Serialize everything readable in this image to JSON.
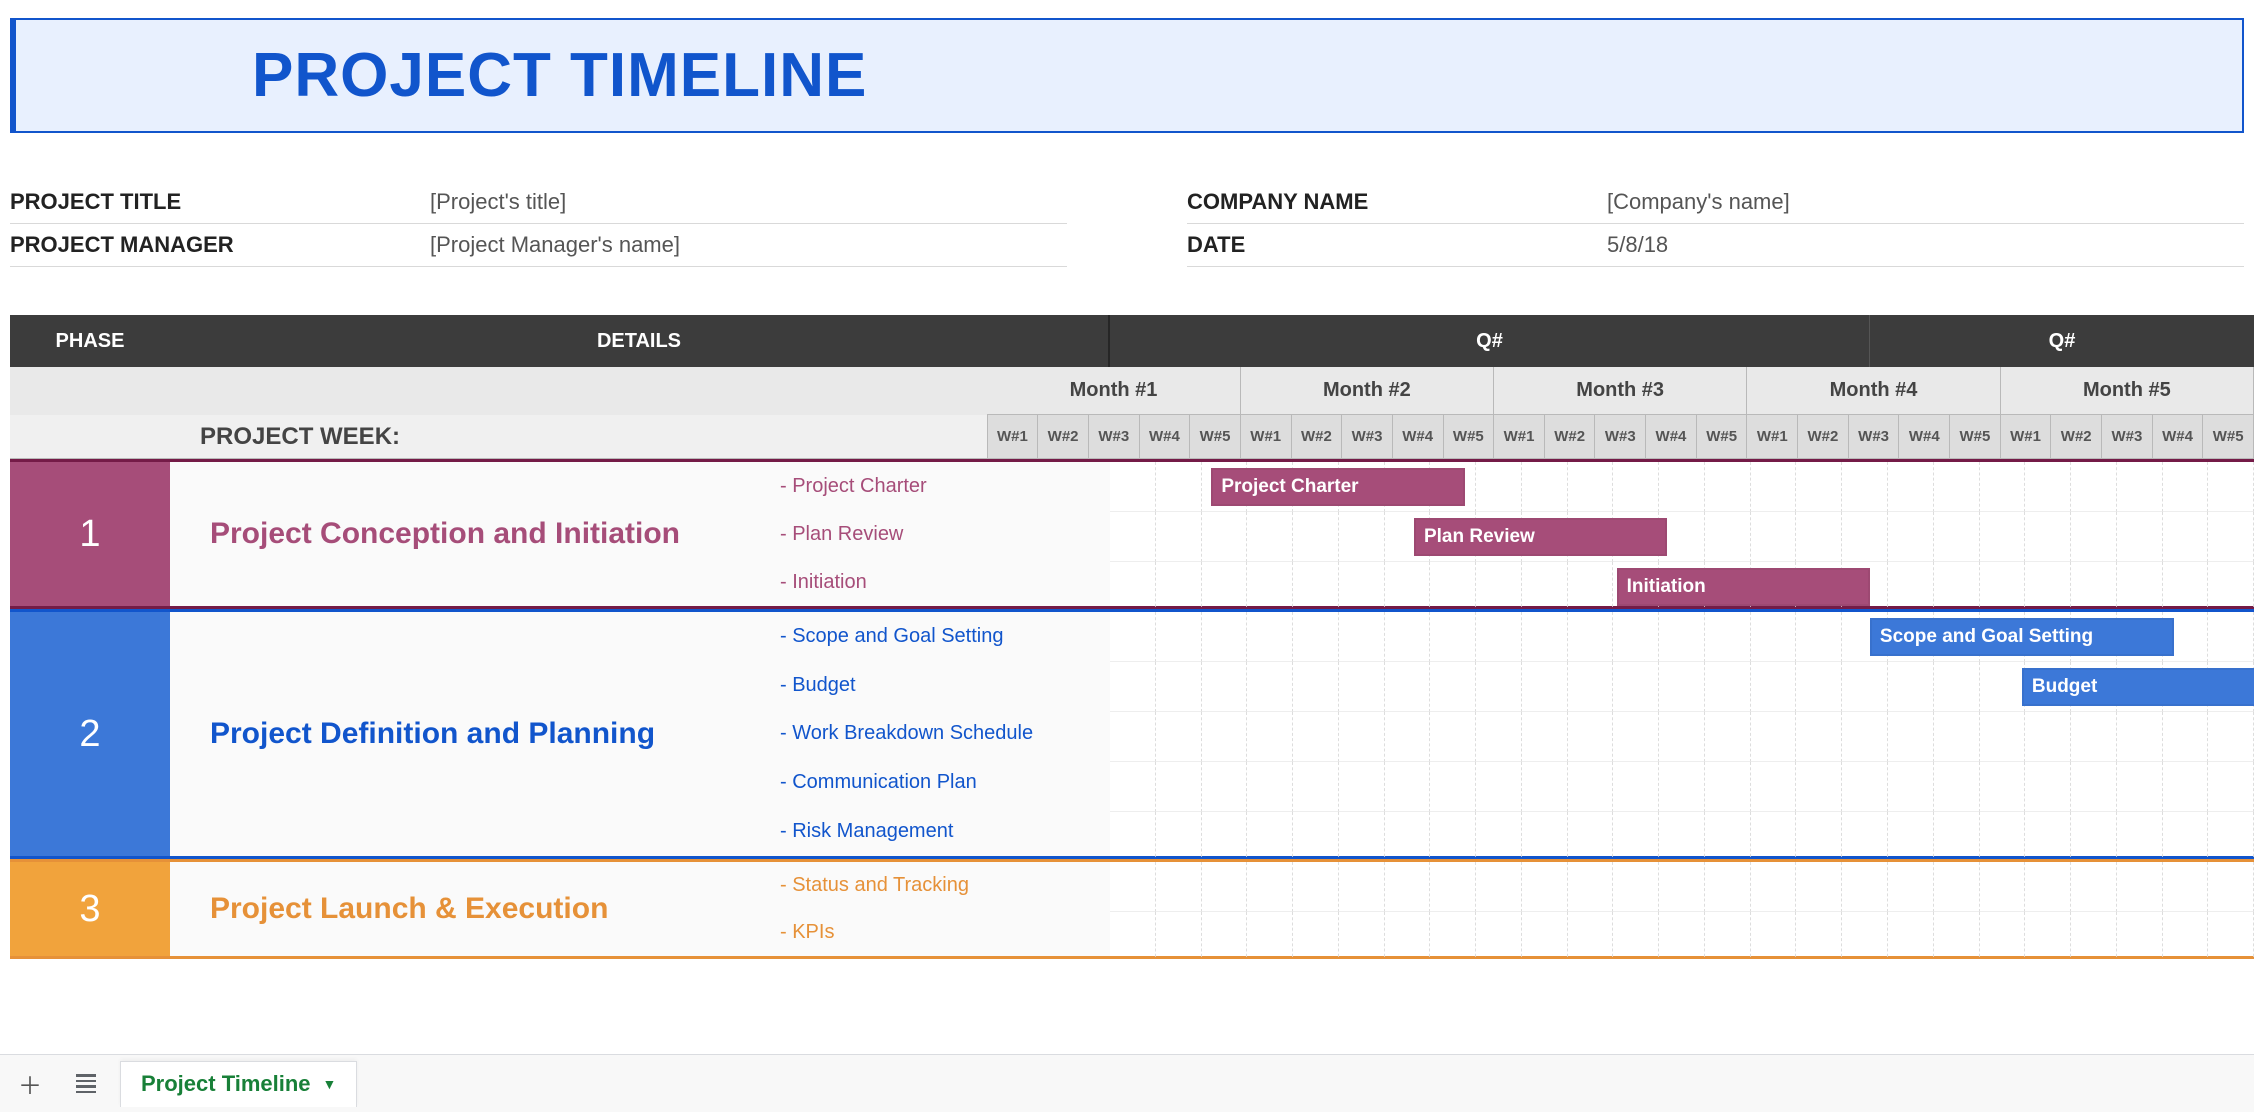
{
  "title": "PROJECT TIMELINE",
  "meta": {
    "project_title_label": "PROJECT TITLE",
    "project_title_value": "[Project's title]",
    "project_manager_label": "PROJECT MANAGER",
    "project_manager_value": "[Project Manager's name]",
    "company_name_label": "COMPANY NAME",
    "company_name_value": "[Company's name]",
    "date_label": "DATE",
    "date_value": "5/8/18"
  },
  "headers": {
    "phase": "PHASE",
    "details": "DETAILS",
    "quarters": [
      "Q#",
      "Q#"
    ],
    "months": [
      "Month #1",
      "Month #2",
      "Month #3",
      "Month #4",
      "Month #5"
    ],
    "weeks_per_month": [
      "W#1",
      "W#2",
      "W#3",
      "W#4",
      "W#5"
    ],
    "project_week": "PROJECT WEEK:"
  },
  "phases": [
    {
      "num": "1",
      "name": "Project Conception and Initiation",
      "color": "maroon",
      "details": [
        "- Project Charter",
        "- Plan Review",
        "- Initiation"
      ],
      "bars": [
        {
          "label": "Project Charter",
          "row": 0,
          "start": 2,
          "span": 5
        },
        {
          "label": "Plan Review",
          "row": 1,
          "start": 6,
          "span": 5
        },
        {
          "label": "Initiation",
          "row": 2,
          "start": 10,
          "span": 5
        }
      ]
    },
    {
      "num": "2",
      "name": "Project Definition and Planning",
      "color": "blue",
      "details": [
        "- Scope and Goal Setting",
        "- Budget",
        "- Work Breakdown Schedule",
        "- Communication Plan",
        "- Risk Management"
      ],
      "bars": [
        {
          "label": "Scope and Goal Setting",
          "row": 0,
          "start": 15,
          "span": 6
        },
        {
          "label": "Budget",
          "row": 1,
          "start": 18,
          "span": 5
        }
      ]
    },
    {
      "num": "3",
      "name": "Project Launch & Execution",
      "color": "orange",
      "details": [
        "- Status and Tracking",
        "- KPIs"
      ],
      "bars": []
    }
  ],
  "sheet_tab": "Project Timeline"
}
